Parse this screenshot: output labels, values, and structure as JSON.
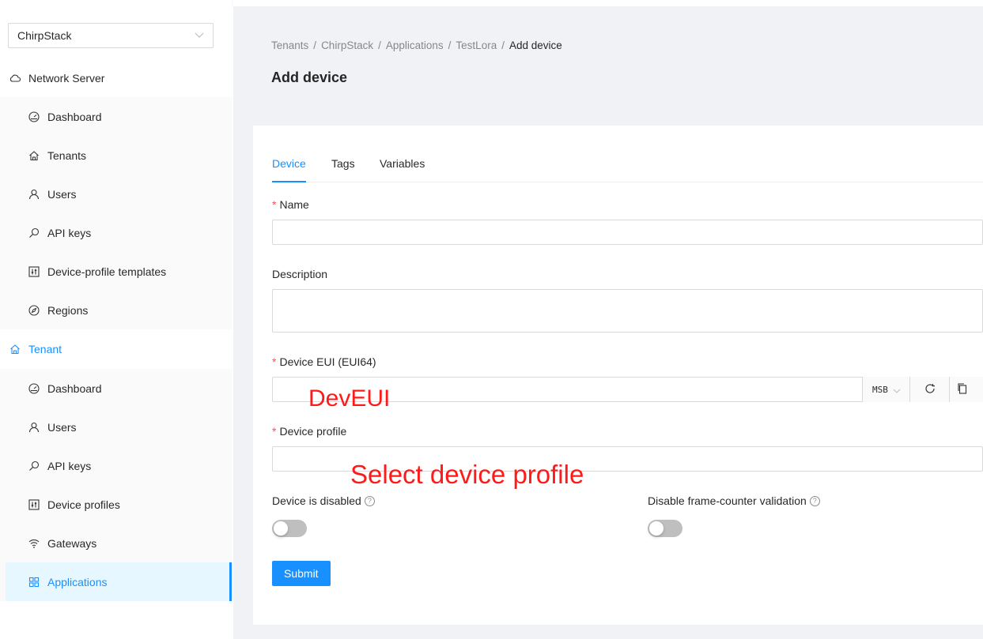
{
  "sidebar": {
    "tenant_select": "ChirpStack",
    "network_server": {
      "label": "Network Server",
      "items": [
        {
          "label": "Dashboard",
          "icon": "dashboard-icon"
        },
        {
          "label": "Tenants",
          "icon": "home-icon"
        },
        {
          "label": "Users",
          "icon": "user-icon"
        },
        {
          "label": "API keys",
          "icon": "key-icon"
        },
        {
          "label": "Device-profile templates",
          "icon": "control-icon"
        },
        {
          "label": "Regions",
          "icon": "compass-icon"
        }
      ]
    },
    "tenant": {
      "label": "Tenant",
      "items": [
        {
          "label": "Dashboard",
          "icon": "dashboard-icon"
        },
        {
          "label": "Users",
          "icon": "user-icon"
        },
        {
          "label": "API keys",
          "icon": "key-icon"
        },
        {
          "label": "Device profiles",
          "icon": "control-icon"
        },
        {
          "label": "Gateways",
          "icon": "wifi-icon"
        },
        {
          "label": "Applications",
          "icon": "appstore-icon"
        }
      ]
    }
  },
  "breadcrumb": [
    "Tenants",
    "ChirpStack",
    "Applications",
    "TestLora",
    "Add device"
  ],
  "page_title": "Add device",
  "tabs": [
    "Device",
    "Tags",
    "Variables"
  ],
  "form": {
    "name_label": "Name",
    "name_value": "",
    "description_label": "Description",
    "description_value": "",
    "dev_eui_label": "Device EUI (EUI64)",
    "dev_eui_value": "",
    "byte_order": "MSB",
    "device_profile_label": "Device profile",
    "device_profile_value": "",
    "device_disabled_label": "Device is disabled",
    "device_disabled": false,
    "skip_fcnt_label": "Disable frame-counter validation",
    "skip_fcnt": false,
    "submit_label": "Submit"
  },
  "annotations": {
    "dev_eui_note": "DevEUI",
    "device_profile_note": "Select device profile",
    "color": "#ff1a1a"
  },
  "colors": {
    "primary": "#1890ff",
    "required": "#ff4d4f",
    "selected_bg": "#e6f7ff"
  }
}
